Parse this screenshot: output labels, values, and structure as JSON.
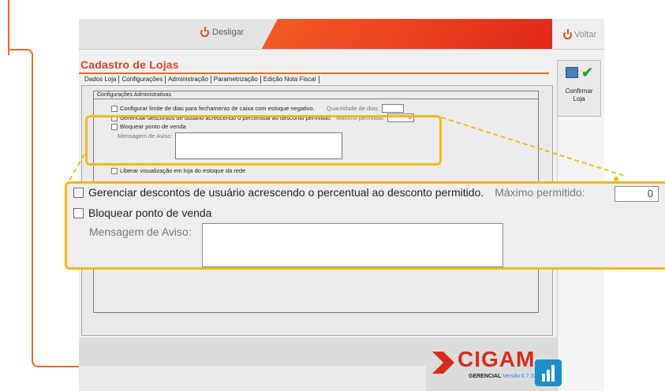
{
  "topbar": {
    "desligar_label": "Desligar",
    "voltar_label": "Voltar"
  },
  "page": {
    "title": "Cadastro de Lojas"
  },
  "tabs": [
    {
      "label": "Dados Loja"
    },
    {
      "label": "Configurações"
    },
    {
      "label": "Administração"
    },
    {
      "label": "Parametrização"
    },
    {
      "label": "Edição Nota Fiscal"
    }
  ],
  "group": {
    "title": "Configurações Administrativas",
    "row1_label": "Configurar limite de dias para fechamento de caixa com estoque negativo.",
    "row1_qty_label": "Quantidade de dias:",
    "row1_qty_value": "",
    "row2_label": "Gerenciar descontos de usuário acrescendo o percentual ao desconto permitido.",
    "row2_max_label": "Máximo permitido:",
    "row2_max_value": "0",
    "row3_label": "Bloquear ponto de venda",
    "row3_msg_label": "Mensagem de Aviso:",
    "row3_msg_value": "",
    "row4_label": "Liberar visualização em loja do estoque da rede"
  },
  "side": {
    "confirm_label_line1": "Confirmar",
    "confirm_label_line2": "Loja"
  },
  "footer": {
    "brand": "CIGAM",
    "edition": "GERENCIAL",
    "version": "Versão 6.7.3270"
  },
  "callout": {
    "row1_label": "Gerenciar descontos de usuário acrescendo o percentual ao desconto permitido.",
    "row1_max_label": "Máximo permitido:",
    "row1_max_value": "0",
    "row2_label": "Bloquear ponto de venda",
    "row2_msg_label": "Mensagem de Aviso:",
    "row2_msg_value": ""
  },
  "colors": {
    "accent": "#e36a2a",
    "highlight": "#f2b91c",
    "brand_red": "#d62c1c"
  }
}
